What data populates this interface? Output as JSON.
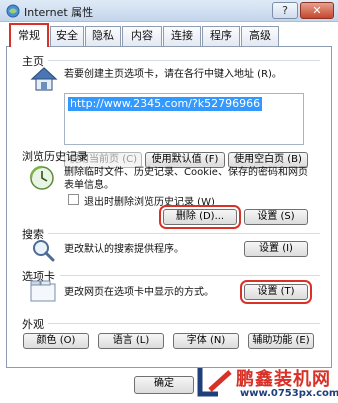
{
  "window": {
    "title": "Internet 属性",
    "help_button": "?",
    "close_button": "✕"
  },
  "tabs": [
    {
      "label": "常规",
      "active": true
    },
    {
      "label": "安全"
    },
    {
      "label": "隐私"
    },
    {
      "label": "内容"
    },
    {
      "label": "连接"
    },
    {
      "label": "程序"
    },
    {
      "label": "高级"
    }
  ],
  "homepage": {
    "section_label": "主页",
    "description": "若要创建主页选项卡，请在各行中键入地址 (R)。",
    "url": "http://www.2345.com/?k52796966",
    "buttons": {
      "use_current": "使用当前页 (C)",
      "use_default": "使用默认值 (F)",
      "use_blank": "使用空白页 (B)"
    }
  },
  "history": {
    "section_label": "浏览历史记录",
    "description_line1": "删除临时文件、历史记录、Cookie、保存的密码和网页",
    "description_line2": "表单信息。",
    "checkbox_label": "退出时删除浏览历史记录 (W)",
    "checkbox_checked": false,
    "buttons": {
      "delete": "删除 (D)...",
      "settings": "设置 (S)"
    }
  },
  "search": {
    "section_label": "搜索",
    "description": "更改默认的搜索提供程序。",
    "settings_button": "设置 (I)"
  },
  "tabs_section": {
    "section_label": "选项卡",
    "description": "更改网页在选项卡中显示的方式。",
    "settings_button": "设置 (T)"
  },
  "appearance": {
    "section_label": "外观",
    "buttons": {
      "colors": "颜色 (O)",
      "languages": "语言 (L)",
      "fonts": "字体 (N)",
      "accessibility": "辅助功能 (E)"
    }
  },
  "footer": {
    "ok": "确定"
  },
  "watermark": {
    "brand": "鹏鑫装机网",
    "url": "www.0753px.com"
  },
  "colors": {
    "highlight_red": "#d83228",
    "selection_blue": "#3399ff"
  }
}
